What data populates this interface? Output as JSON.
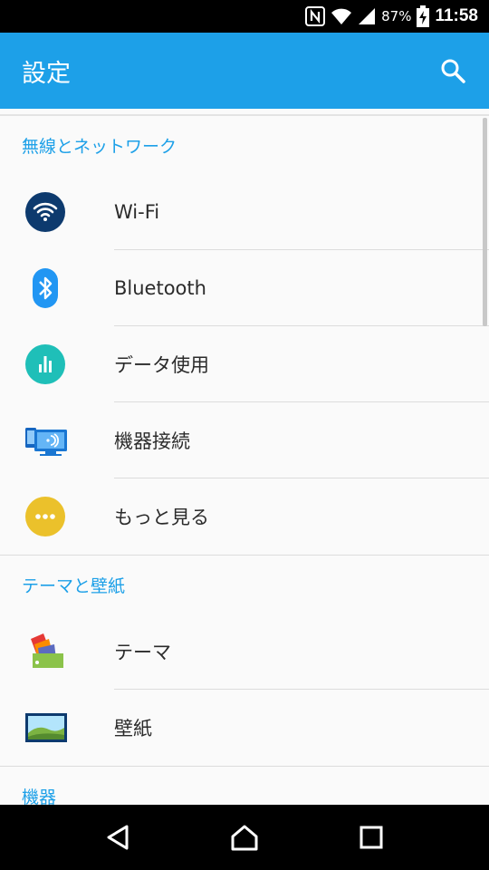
{
  "status_bar": {
    "battery_percent": "87%",
    "time": "11:58",
    "icons": [
      "nfc-icon",
      "wifi-icon",
      "signal-icon",
      "battery-charging-icon"
    ]
  },
  "app_bar": {
    "title": "設定",
    "search_icon": "search-icon"
  },
  "sections": [
    {
      "header": "無線とネットワーク",
      "items": [
        {
          "label": "Wi-Fi",
          "icon": "wifi-icon"
        },
        {
          "label": "Bluetooth",
          "icon": "bluetooth-icon"
        },
        {
          "label": "データ使用",
          "icon": "data-usage-icon"
        },
        {
          "label": "機器接続",
          "icon": "device-connection-icon"
        },
        {
          "label": "もっと見る",
          "icon": "more-icon"
        }
      ]
    },
    {
      "header": "テーマと壁紙",
      "items": [
        {
          "label": "テーマ",
          "icon": "theme-icon"
        },
        {
          "label": "壁紙",
          "icon": "wallpaper-icon"
        }
      ]
    },
    {
      "header": "機器"
    }
  ],
  "nav_bar": {
    "back": "back-icon",
    "home": "home-icon",
    "recents": "recents-icon"
  },
  "colors": {
    "accent": "#1da0e8",
    "wifi_icon_bg": "#0d3a6e",
    "bluetooth_icon_bg": "#2196f3",
    "data_icon_bg": "#1fbfb8",
    "more_icon_bg": "#ebc12b"
  }
}
